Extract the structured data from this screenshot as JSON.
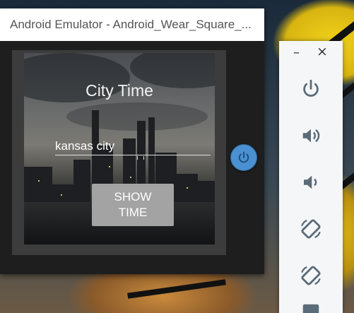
{
  "window": {
    "title": "Android Emulator - Android_Wear_Square_..."
  },
  "app": {
    "title": "City Time",
    "city_input_value": "kansas city",
    "button_label": "SHOW\nTIME"
  },
  "toolbar": {
    "minimize_glyph": "–",
    "close_glyph": "×",
    "buttons": [
      "power-icon",
      "volume-up-icon",
      "volume-down-icon",
      "rotate-left-icon",
      "rotate-right-icon"
    ]
  },
  "colors": {
    "accent": "#4b90d0",
    "toolbar_icon": "#5a6b7a",
    "button_bg": "#a3a3a3"
  }
}
